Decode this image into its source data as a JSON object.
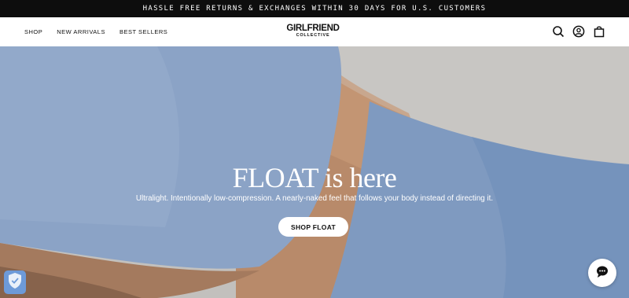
{
  "announcement": "HASSLE FREE RETURNS & EXCHANGES WITHIN 30 DAYS FOR U.S. CUSTOMERS",
  "nav": {
    "items": [
      {
        "label": "SHOP"
      },
      {
        "label": "NEW ARRIVALS"
      },
      {
        "label": "BEST SELLERS"
      }
    ]
  },
  "logo": {
    "line1": "GIRLFRIEND",
    "line2": "COLLECTIVE"
  },
  "header_icons": [
    "search-icon",
    "account-icon",
    "cart-icon"
  ],
  "hero": {
    "headline": "FLOAT is here",
    "subheadline": "Ultralight. Intentionally low-compression. A nearly-naked feel that follows your body instead of directing it.",
    "cta": "SHOP FLOAT"
  },
  "widgets": {
    "chat_icon": "chat-icon",
    "shield_icon": "shield-check-icon"
  },
  "colors": {
    "announcement_bg": "#0d0d0d",
    "fabric_blue": "#7f9ac0",
    "skin": "#b88a6a",
    "background": "#c6c4c1"
  }
}
